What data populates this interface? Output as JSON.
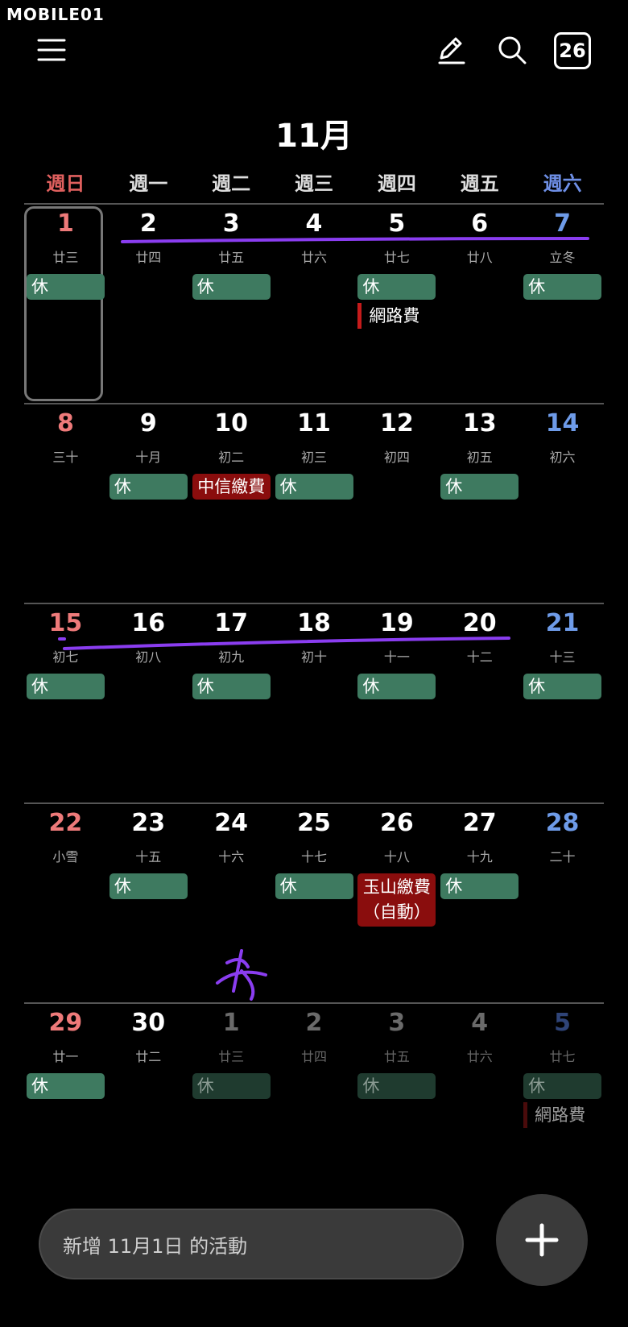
{
  "watermark": "MOBILE01",
  "header": {
    "month_title": "11月",
    "today_badge": "26",
    "icons": [
      "menu-icon",
      "pen-icon",
      "search-icon",
      "today-icon"
    ]
  },
  "weekdays": [
    "週日",
    "週一",
    "週二",
    "週三",
    "週四",
    "週五",
    "週六"
  ],
  "weeks": [
    {
      "days": [
        {
          "num": "1",
          "lunar": "廿三",
          "events": [
            {
              "label": "休"
            }
          ],
          "today": true
        },
        {
          "num": "2",
          "lunar": "廿四"
        },
        {
          "num": "3",
          "lunar": "廿五",
          "events": [
            {
              "label": "休"
            }
          ]
        },
        {
          "num": "4",
          "lunar": "廿六"
        },
        {
          "num": "5",
          "lunar": "廿七",
          "events": [
            {
              "label": "休"
            }
          ],
          "task": "網路費"
        },
        {
          "num": "6",
          "lunar": "廿八"
        },
        {
          "num": "7",
          "lunar": "立冬",
          "events": [
            {
              "label": "休"
            }
          ]
        }
      ]
    },
    {
      "days": [
        {
          "num": "8",
          "lunar": "三十"
        },
        {
          "num": "9",
          "lunar": "十月",
          "events": [
            {
              "label": "休"
            }
          ]
        },
        {
          "num": "10",
          "lunar": "初二",
          "events": [
            {
              "label": "中信繳費",
              "type": "red"
            }
          ]
        },
        {
          "num": "11",
          "lunar": "初三",
          "events": [
            {
              "label": "休"
            }
          ]
        },
        {
          "num": "12",
          "lunar": "初四"
        },
        {
          "num": "13",
          "lunar": "初五",
          "events": [
            {
              "label": "休"
            }
          ]
        },
        {
          "num": "14",
          "lunar": "初六"
        }
      ]
    },
    {
      "days": [
        {
          "num": "15",
          "lunar": "初七",
          "events": [
            {
              "label": "休"
            }
          ]
        },
        {
          "num": "16",
          "lunar": "初八"
        },
        {
          "num": "17",
          "lunar": "初九",
          "events": [
            {
              "label": "休"
            }
          ]
        },
        {
          "num": "18",
          "lunar": "初十"
        },
        {
          "num": "19",
          "lunar": "十一",
          "events": [
            {
              "label": "休"
            }
          ]
        },
        {
          "num": "20",
          "lunar": "十二"
        },
        {
          "num": "21",
          "lunar": "十三",
          "events": [
            {
              "label": "休"
            }
          ]
        }
      ]
    },
    {
      "days": [
        {
          "num": "22",
          "lunar": "小雪"
        },
        {
          "num": "23",
          "lunar": "十五",
          "events": [
            {
              "label": "休"
            }
          ]
        },
        {
          "num": "24",
          "lunar": "十六"
        },
        {
          "num": "25",
          "lunar": "十七",
          "events": [
            {
              "label": "休"
            }
          ]
        },
        {
          "num": "26",
          "lunar": "十八",
          "events": [
            {
              "label": "玉山繳費（自動）",
              "type": "red-tall"
            }
          ]
        },
        {
          "num": "27",
          "lunar": "十九",
          "events": [
            {
              "label": "休"
            }
          ]
        },
        {
          "num": "28",
          "lunar": "二十"
        }
      ]
    },
    {
      "days": [
        {
          "num": "29",
          "lunar": "廿一",
          "events": [
            {
              "label": "休"
            }
          ]
        },
        {
          "num": "30",
          "lunar": "廿二"
        },
        {
          "num": "1",
          "lunar": "廿三",
          "dim": true,
          "events": [
            {
              "label": "休"
            }
          ]
        },
        {
          "num": "2",
          "lunar": "廿四",
          "dim": true
        },
        {
          "num": "3",
          "lunar": "廿五",
          "dim": true,
          "events": [
            {
              "label": "休"
            }
          ]
        },
        {
          "num": "4",
          "lunar": "廿六",
          "dim": true
        },
        {
          "num": "5",
          "lunar": "廿七",
          "dim": true,
          "events": [
            {
              "label": "休"
            }
          ],
          "task": "網路費"
        }
      ]
    }
  ],
  "add_bar": {
    "placeholder": "新增 11月1日 的活動"
  },
  "colors": {
    "event_green": "#3e7a60",
    "event_red": "#8a0d0d",
    "sunday": "#ee7a7a",
    "saturday": "#6e9be8",
    "annotation": "#8a3df0"
  }
}
